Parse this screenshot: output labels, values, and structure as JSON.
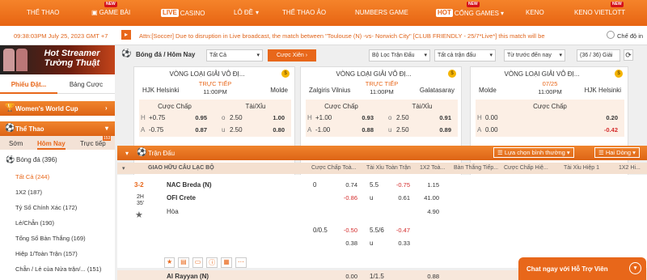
{
  "nav": {
    "items": [
      {
        "label": "THỂ THAO"
      },
      {
        "label": "GAME BÀI",
        "badge": "NEW"
      },
      {
        "label": "CASINO",
        "badge_pre": "LIVE"
      },
      {
        "label": "LÔ ĐỀ",
        "caret": "▾"
      },
      {
        "label": "THỂ THAO ẢO"
      },
      {
        "label": "NUMBERS GAME"
      },
      {
        "label": "CỔNG GAMES",
        "badge_pre": "HOT",
        "badge": "NEW",
        "caret": "▾"
      },
      {
        "label": "KENO"
      },
      {
        "label": "KENO VIETLOTT",
        "badge": "NEW"
      }
    ]
  },
  "sub": {
    "time": "09:38:03PM July 25, 2023 GMT +7",
    "ticker": "Attn:[Soccer] Due to disruption in Live broadcast, the match between \"Toulouse (N) -vs- Norwich City\" [CLUB FRIENDLY - 25/7*Live*] this match will be",
    "toggle_label": "Chế độ in"
  },
  "left": {
    "banner": "Hot Streamer Tường Thuật",
    "tabs": [
      "Phiếu Đặt...",
      "Bảng Cược"
    ],
    "womens": "Women's World Cup",
    "sports": "Thể Thao",
    "subtabs": [
      "Sớm",
      "Hôm Nay",
      "Trực tiếp"
    ],
    "live_count": "153",
    "list_header": "Bóng đá (396)",
    "list": [
      "Tất Cả (244)",
      "1X2 (187)",
      "Tỷ Số Chính Xác (172)",
      "Lẻ/Chẵn (190)",
      "Tổng Số Bàn Thắng (169)",
      "Hiệp 1/Toàn Trận (157)",
      "Chẵn / Lẻ của Nửa trận/... (151)"
    ]
  },
  "toolbar": {
    "title": "Bóng đá / Hôm Nay",
    "filter": "Tất Cả",
    "parlay": "Cược Xiên",
    "league_filter": "Bộ Lọc Trận Đấu",
    "all_matches": "Tất cả trận đấu",
    "time_filter": "Từ trước đến nay",
    "count": "(36 / 36) Giải"
  },
  "cards": [
    {
      "league": "VÒNG LOẠI GIẢI VÔ ĐỊ...",
      "home": "HJK Helsinki",
      "away": "Molde",
      "status1": "TRỰC TIẾP",
      "status2": "11:00PM",
      "m1": "Cược Chấp",
      "m2": "Tài/Xỉu",
      "rows": [
        [
          "H",
          "+0.75",
          "0.95",
          "o",
          "2.50",
          "1.00"
        ],
        [
          "A",
          "-0.75",
          "0.87",
          "u",
          "2.50",
          "0.80"
        ]
      ]
    },
    {
      "league": "VÒNG LOẠI GIẢI VÔ ĐỊ...",
      "home": "Zalgiris Vilnius",
      "away": "Galatasaray",
      "status1": "TRỰC TIẾP",
      "status2": "11:00PM",
      "m1": "Cược Chấp",
      "m2": "Tài/Xỉu",
      "rows": [
        [
          "H",
          "+1.00",
          "0.93",
          "o",
          "2.50",
          "0.91"
        ],
        [
          "A",
          "-1.00",
          "0.88",
          "u",
          "2.50",
          "0.89"
        ]
      ]
    },
    {
      "league": "VÒNG LOẠI GIẢI VÔ ĐỊ...",
      "home": "Molde",
      "away": "HJK Helsinki",
      "status1": "07/25",
      "status2": "11:00PM",
      "m1": "Cược Chấp",
      "rows": [
        [
          "H",
          "0.00",
          "0.20"
        ],
        [
          "A",
          "0.00",
          "-0.42"
        ]
      ]
    }
  ],
  "section": {
    "title": "Trận Đấu",
    "sort": "Lựa chọn bình thường",
    "lines": "Hai Dòng"
  },
  "table": {
    "headers": [
      "GIAO HỮU CÂU LẠC BỘ",
      "Cược Chấp Toà...",
      "Tài Xỉu Toàn Trận",
      "1X2 Toà...",
      "Bàn Thắng Tiếp...",
      "Cược Chấp Hiệ...",
      "Tài Xỉu Hiệp 1",
      "1X2 Hi..."
    ],
    "score": "3-2",
    "period": "2H",
    "minute": "35'",
    "home": "NAC Breda (N)",
    "away": "OFI Crete",
    "draw": "Hòa",
    "hc1": [
      "0",
      "0.74",
      "-0.86"
    ],
    "ou1": [
      "5.5",
      "-0.75",
      "u",
      "0.61"
    ],
    "x12": [
      "1.15",
      "41.00",
      "4.90"
    ],
    "hc2": [
      "0/0.5",
      "-0.50",
      "0.38"
    ],
    "ou2": [
      "5.5/6",
      "-0.47",
      "u",
      "0.33"
    ],
    "next_team": "Al Rayyan (N)",
    "next_vals": [
      "0.00",
      "1/1.5",
      "0.88"
    ]
  },
  "chat": {
    "label": "Chat ngay với Hỗ Trợ Viên"
  }
}
